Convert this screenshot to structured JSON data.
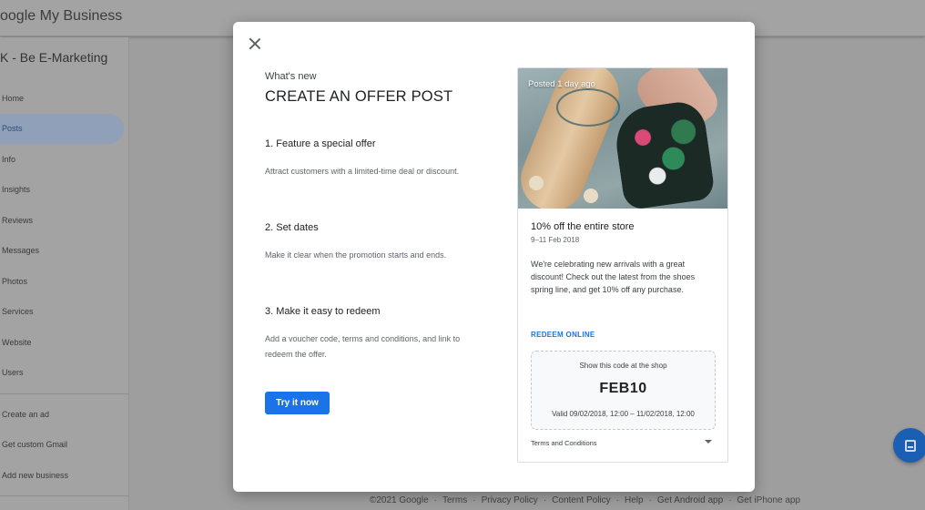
{
  "app": {
    "logo_google": "oogle",
    "logo_product": "My Business"
  },
  "business": {
    "name": "K - Be E-Marketing"
  },
  "sidebar": {
    "items": [
      {
        "label": "Home"
      },
      {
        "label": "Posts",
        "active": true
      },
      {
        "label": "Info"
      },
      {
        "label": "Insights"
      },
      {
        "label": "Reviews"
      },
      {
        "label": "Messages"
      },
      {
        "label": "Photos"
      },
      {
        "label": "Services"
      },
      {
        "label": "Website"
      },
      {
        "label": "Users"
      }
    ],
    "secondary": [
      {
        "label": "Create an ad"
      },
      {
        "label": "Get custom Gmail"
      },
      {
        "label": "Add new business"
      }
    ]
  },
  "footer": {
    "copyright": "©2021 Google",
    "links": [
      "Terms",
      "Privacy Policy",
      "Content Policy",
      "Help",
      "Get Android app",
      "Get iPhone app"
    ]
  },
  "modal": {
    "eyebrow": "What's new",
    "title": "CREATE AN OFFER POST",
    "steps": [
      {
        "title": "1. Feature a special offer",
        "desc": "Attract customers with a limited-time deal or discount."
      },
      {
        "title": "2. Set dates",
        "desc": "Make it clear when the promotion starts and ends."
      },
      {
        "title": "3. Make it easy to redeem",
        "desc": "Add a voucher code, terms and conditions, and link to redeem the offer."
      }
    ],
    "cta": "Try it now"
  },
  "preview": {
    "posted": "Posted 1 day ago",
    "title": "10% off the entire store",
    "dates": "9–11 Feb 2018",
    "description": "We're celebrating new arrivals with a great discount! Check out the latest from the shoes spring line, and get 10% off any purchase.",
    "redeem": "REDEEM ONLINE",
    "code_label": "Show this code at the shop",
    "code": "FEB10",
    "valid": "Valid 09/02/2018, 12:00 – 11/02/2018, 12:00",
    "terms": "Terms and Conditions"
  },
  "colors": {
    "primary": "#1a73e8",
    "overlay": "#9e9e9e"
  },
  "icons": {
    "close": "close-icon",
    "expand": "chevron-down-icon",
    "fab": "feedback-icon"
  }
}
